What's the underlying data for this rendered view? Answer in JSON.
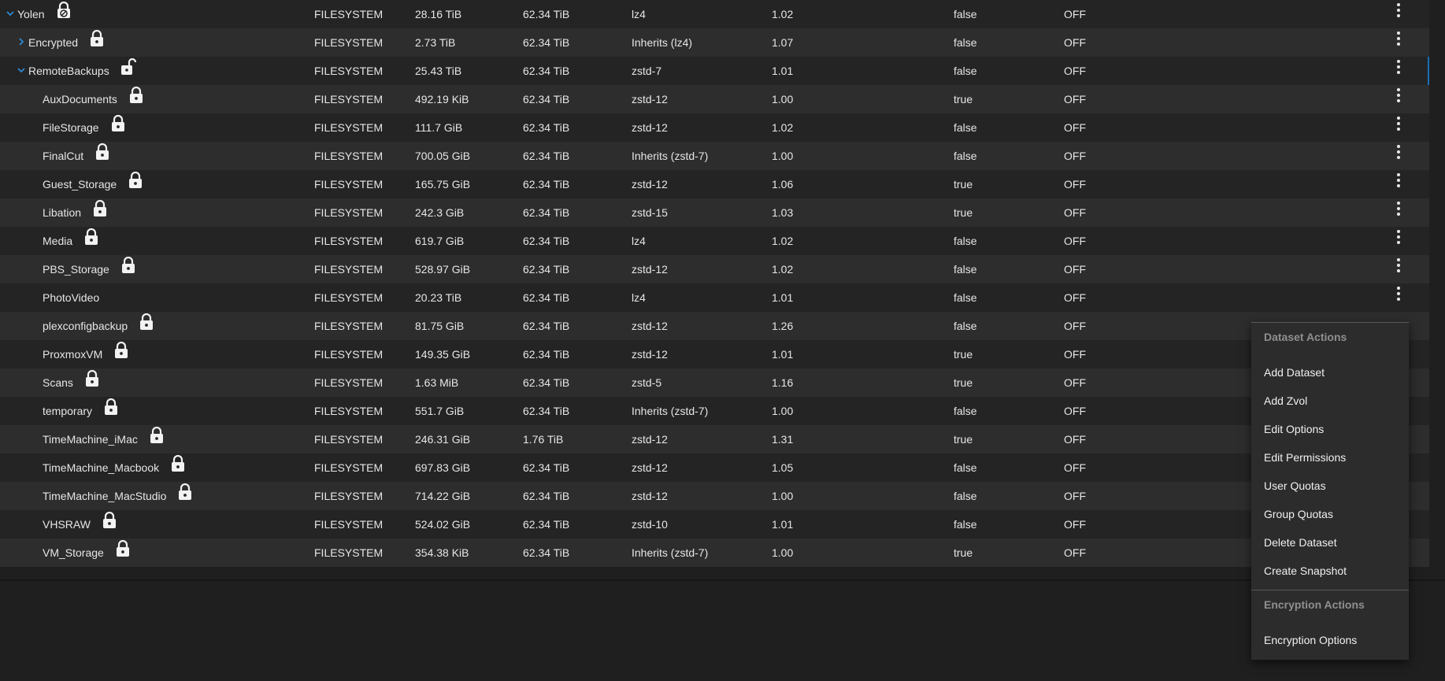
{
  "rows": [
    {
      "name": "Yolen",
      "level": 0,
      "chevron": "down",
      "lock": "pool-locked",
      "type": "FILESYSTEM",
      "used": "28.16 TiB",
      "available": "62.34 TiB",
      "compression": "lz4",
      "ratio": "1.02",
      "readonly": "false",
      "dedup": "OFF",
      "menu": true
    },
    {
      "name": "Encrypted",
      "level": 1,
      "chevron": "right",
      "lock": "locked",
      "type": "FILESYSTEM",
      "used": "2.73 TiB",
      "available": "62.34 TiB",
      "compression": "Inherits (lz4)",
      "ratio": "1.07",
      "readonly": "false",
      "dedup": "OFF",
      "menu": true
    },
    {
      "name": "RemoteBackups",
      "level": 1,
      "chevron": "down",
      "lock": "unlocked",
      "type": "FILESYSTEM",
      "used": "25.43 TiB",
      "available": "62.34 TiB",
      "compression": "zstd-7",
      "ratio": "1.01",
      "readonly": "false",
      "dedup": "OFF",
      "menu": true,
      "selected": true
    },
    {
      "name": "AuxDocuments",
      "level": 2,
      "lock": "locked",
      "type": "FILESYSTEM",
      "used": "492.19 KiB",
      "available": "62.34 TiB",
      "compression": "zstd-12",
      "ratio": "1.00",
      "readonly": "true",
      "dedup": "OFF",
      "menu": true
    },
    {
      "name": "FileStorage",
      "level": 2,
      "lock": "locked",
      "type": "FILESYSTEM",
      "used": "111.7 GiB",
      "available": "62.34 TiB",
      "compression": "zstd-12",
      "ratio": "1.02",
      "readonly": "false",
      "dedup": "OFF",
      "menu": true
    },
    {
      "name": "FinalCut",
      "level": 2,
      "lock": "locked",
      "type": "FILESYSTEM",
      "used": "700.05 GiB",
      "available": "62.34 TiB",
      "compression": "Inherits (zstd-7)",
      "ratio": "1.00",
      "readonly": "false",
      "dedup": "OFF",
      "menu": true
    },
    {
      "name": "Guest_Storage",
      "level": 2,
      "lock": "locked",
      "type": "FILESYSTEM",
      "used": "165.75 GiB",
      "available": "62.34 TiB",
      "compression": "zstd-12",
      "ratio": "1.06",
      "readonly": "true",
      "dedup": "OFF",
      "menu": true
    },
    {
      "name": "Libation",
      "level": 2,
      "lock": "locked",
      "type": "FILESYSTEM",
      "used": "242.3 GiB",
      "available": "62.34 TiB",
      "compression": "zstd-15",
      "ratio": "1.03",
      "readonly": "true",
      "dedup": "OFF",
      "menu": true
    },
    {
      "name": "Media",
      "level": 2,
      "lock": "locked",
      "type": "FILESYSTEM",
      "used": "619.7 GiB",
      "available": "62.34 TiB",
      "compression": "lz4",
      "ratio": "1.02",
      "readonly": "false",
      "dedup": "OFF",
      "menu": true
    },
    {
      "name": "PBS_Storage",
      "level": 2,
      "lock": "locked",
      "type": "FILESYSTEM",
      "used": "528.97 GiB",
      "available": "62.34 TiB",
      "compression": "zstd-12",
      "ratio": "1.02",
      "readonly": "false",
      "dedup": "OFF",
      "menu": true
    },
    {
      "name": "PhotoVideo",
      "level": 2,
      "lock": "none",
      "type": "FILESYSTEM",
      "used": "20.23 TiB",
      "available": "62.34 TiB",
      "compression": "lz4",
      "ratio": "1.01",
      "readonly": "false",
      "dedup": "OFF",
      "menu": true
    },
    {
      "name": "plexconfigbackup",
      "level": 2,
      "lock": "locked",
      "type": "FILESYSTEM",
      "used": "81.75 GiB",
      "available": "62.34 TiB",
      "compression": "zstd-12",
      "ratio": "1.26",
      "readonly": "false",
      "dedup": "OFF",
      "menu": false
    },
    {
      "name": "ProxmoxVM",
      "level": 2,
      "lock": "locked",
      "type": "FILESYSTEM",
      "used": "149.35 GiB",
      "available": "62.34 TiB",
      "compression": "zstd-12",
      "ratio": "1.01",
      "readonly": "true",
      "dedup": "OFF",
      "menu": false
    },
    {
      "name": "Scans",
      "level": 2,
      "lock": "locked",
      "type": "FILESYSTEM",
      "used": "1.63 MiB",
      "available": "62.34 TiB",
      "compression": "zstd-5",
      "ratio": "1.16",
      "readonly": "true",
      "dedup": "OFF",
      "menu": false
    },
    {
      "name": "temporary",
      "level": 2,
      "lock": "locked",
      "type": "FILESYSTEM",
      "used": "551.7 GiB",
      "available": "62.34 TiB",
      "compression": "Inherits (zstd-7)",
      "ratio": "1.00",
      "readonly": "false",
      "dedup": "OFF",
      "menu": false
    },
    {
      "name": "TimeMachine_iMac",
      "level": 2,
      "lock": "locked",
      "type": "FILESYSTEM",
      "used": "246.31 GiB",
      "available": "1.76 TiB",
      "compression": "zstd-12",
      "ratio": "1.31",
      "readonly": "true",
      "dedup": "OFF",
      "menu": false
    },
    {
      "name": "TimeMachine_Macbook",
      "level": 2,
      "lock": "locked",
      "type": "FILESYSTEM",
      "used": "697.83 GiB",
      "available": "62.34 TiB",
      "compression": "zstd-12",
      "ratio": "1.05",
      "readonly": "false",
      "dedup": "OFF",
      "menu": false
    },
    {
      "name": "TimeMachine_MacStudio",
      "level": 2,
      "lock": "locked",
      "type": "FILESYSTEM",
      "used": "714.22 GiB",
      "available": "62.34 TiB",
      "compression": "zstd-12",
      "ratio": "1.00",
      "readonly": "false",
      "dedup": "OFF",
      "menu": false
    },
    {
      "name": "VHSRAW",
      "level": 2,
      "lock": "locked",
      "type": "FILESYSTEM",
      "used": "524.02 GiB",
      "available": "62.34 TiB",
      "compression": "zstd-10",
      "ratio": "1.01",
      "readonly": "false",
      "dedup": "OFF",
      "menu": false
    },
    {
      "name": "VM_Storage",
      "level": 2,
      "lock": "locked",
      "type": "FILESYSTEM",
      "used": "354.38 KiB",
      "available": "62.34 TiB",
      "compression": "Inherits (zstd-7)",
      "ratio": "1.00",
      "readonly": "true",
      "dedup": "OFF",
      "menu": false
    }
  ],
  "context_menu": {
    "dataset_header": "Dataset Actions",
    "dataset_items": [
      "Add Dataset",
      "Add Zvol",
      "Edit Options",
      "Edit Permissions",
      "User Quotas",
      "Group Quotas",
      "Delete Dataset",
      "Create Snapshot"
    ],
    "encryption_header": "Encryption Actions",
    "encryption_items": [
      "Encryption Options"
    ]
  },
  "colors": {
    "accent": "#2b8ad6",
    "row_dark": "#242424",
    "row_light": "#2d2d2d",
    "text": "#e6e6e6"
  }
}
